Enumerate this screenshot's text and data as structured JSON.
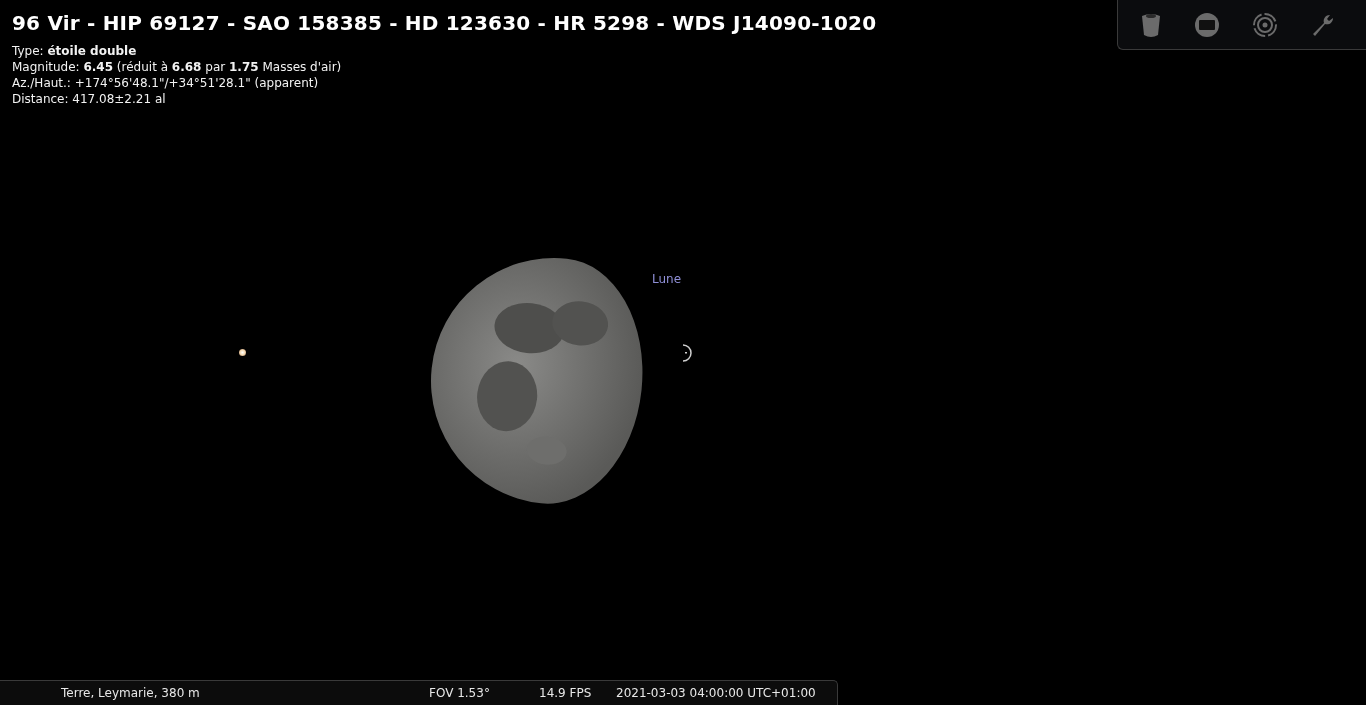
{
  "object_title": "96 Vir - HIP 69127 - SAO 158385 - HD 123630 - HR 5298 - WDS J14090-1020",
  "info_lines": [
    "Type: **étoile double**",
    "Magnitude: **6.45** (réduit à **6.68** par **1.75** Masses d'air)",
    "Az./Haut.: +174°56'48.1\"/+34°51'28.1\" (apparent)",
    "Distance: 417.08±2.21 al"
  ],
  "sky_labels": [
    {
      "text": "Lune"
    }
  ],
  "status_bar": {
    "location": "Terre, Leymarie, 380 m",
    "fov": "FOV 1.53°",
    "fps": "14.9 FPS",
    "datetime": "2021-03-03 04:00:00 UTC+01:00"
  }
}
